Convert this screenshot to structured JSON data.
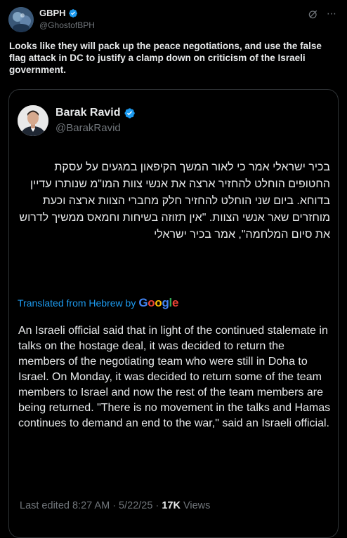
{
  "outer_post": {
    "display_name": "GBPH",
    "handle": "@GhostofBPH",
    "text": "Looks like they will pack up the peace negotiations, and use the false flag attack in DC to justify a clamp down on criticism of the Israeli government.",
    "verified_icon": "verified-badge-icon",
    "grok_icon": "grok-icon",
    "more_icon": "more-icon"
  },
  "quoted_post": {
    "display_name": "Barak Ravid",
    "handle": "@BarakRavid",
    "verified_icon": "verified-badge-icon",
    "hebrew_text": "בכיר ישראלי אמר כי לאור המשך הקיפאון במגעים על עסקת החטופים הוחלט להחזיר ארצה את אנשי צוות המו\"מ שנותרו עדיין בדוחא. ביום שני הוחלט להחזיר חלק מחברי הצוות ארצה וכעת מוחזרים שאר אנשי הצוות. \"אין תזוזה בשיחות וחמאס ממשיך לדרוש את סיום המלחמה\", אמר בכיר ישראלי",
    "translated_label": "Translated from Hebrew by",
    "translation_provider": "Google",
    "english_text": "An Israeli official said that in light of the continued stalemate in talks on the hostage deal, it was decided to return the members of the negotiating team who were still in Doha to Israel. On Monday, it was decided to return some of the team members to Israel and now the rest of the team members are being returned. \"There is no movement in the talks and Hamas continues to demand an end to the war,\" said an Israeli official.",
    "last_edited": "Last edited 8:27 AM · 5/22/25 · ",
    "views_count": "17K",
    "views_label": " Views"
  },
  "colors": {
    "background": "#000000",
    "text_primary": "#e7e9ea",
    "text_secondary": "#71767b",
    "accent_blue": "#1d9bf0",
    "border": "#2f3336"
  }
}
